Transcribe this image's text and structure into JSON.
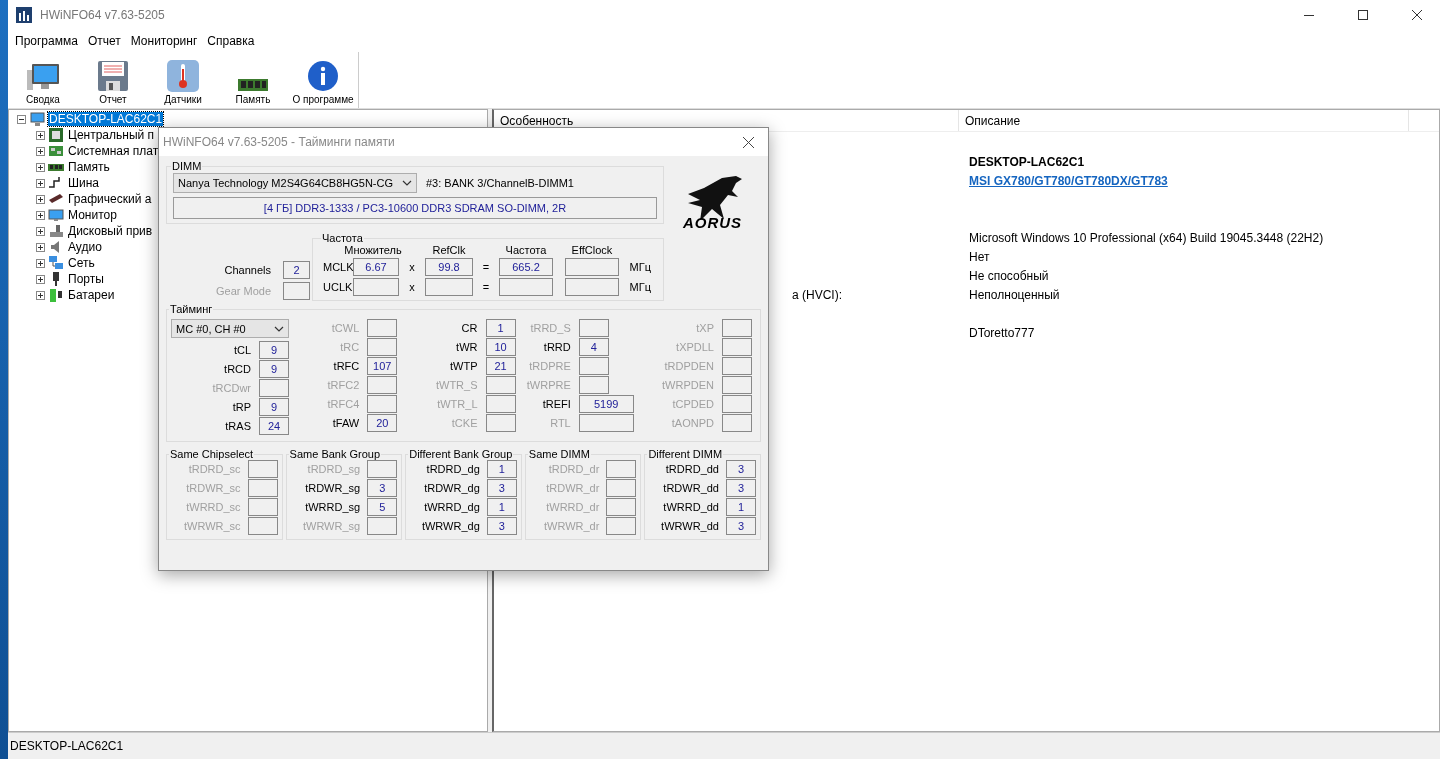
{
  "window": {
    "title": "HWiNFO64 v7.63-5205"
  },
  "menu": [
    "Программа",
    "Отчет",
    "Мониторинг",
    "Справка"
  ],
  "toolbar": [
    {
      "label": "Сводка",
      "kind": "computer"
    },
    {
      "label": "Отчет",
      "kind": "disk"
    },
    {
      "label": "Датчики",
      "kind": "sensor"
    },
    {
      "label": "Память",
      "kind": "memory"
    },
    {
      "label": "О программе",
      "kind": "info"
    }
  ],
  "tree": {
    "label": "DESKTOP-LAC62C1",
    "selected": true,
    "expanded": true,
    "children": [
      {
        "label": "Центральный п",
        "kind": "cpu",
        "selected": false,
        "expanded": false
      },
      {
        "label": "Системная плат",
        "kind": "board",
        "selected": false,
        "expanded": false
      },
      {
        "label": "Память",
        "kind": "memory",
        "selected": false,
        "expanded": false
      },
      {
        "label": "Шина",
        "kind": "bus",
        "selected": false,
        "expanded": false
      },
      {
        "label": "Графический а",
        "kind": "gpu",
        "selected": false,
        "expanded": false
      },
      {
        "label": "Монитор",
        "kind": "monitor",
        "selected": false,
        "expanded": false
      },
      {
        "label": "Дисковый прив",
        "kind": "drive",
        "selected": false,
        "expanded": false
      },
      {
        "label": "Аудио",
        "kind": "audio",
        "selected": false,
        "expanded": false
      },
      {
        "label": "Сеть",
        "kind": "network",
        "selected": false,
        "expanded": false
      },
      {
        "label": "Порты",
        "kind": "port",
        "selected": false,
        "expanded": false
      },
      {
        "label": "Батареи",
        "kind": "battery",
        "selected": false,
        "expanded": false
      }
    ]
  },
  "details": {
    "columns": [
      "Особенность",
      "Описание"
    ],
    "rows": [
      {
        "kind": "bold",
        "value": "DESKTOP-LAC62C1"
      },
      {
        "kind": "link",
        "value": "MSI GX780/GT780/GT780DX/GT783"
      },
      {
        "kind": "blank"
      },
      {
        "kind": "blank"
      },
      {
        "kind": "plain",
        "value": "Microsoft Windows 10 Professional (x64) Build 19045.3448 (22H2)"
      },
      {
        "kind": "plain",
        "value": "Нет"
      },
      {
        "kind": "plain",
        "value": "Не способный"
      },
      {
        "kind": "plain",
        "feature": "а (HVCI):",
        "value": "Неполноценный"
      },
      {
        "kind": "blank"
      },
      {
        "kind": "plain",
        "value": "DToretto777"
      }
    ]
  },
  "status_bar": "DESKTOP-LAC62C1",
  "dialog": {
    "title": "HWiNFO64 v7.63-5205 - Тайминги памяти",
    "dimm": {
      "legend": "DIMM",
      "module": "Nanya Technology M2S4G64CB8HG5N-CG",
      "slot": "#3: BANK 3/ChannelB-DIMM1",
      "info": "[4 ГБ] DDR3-1333 / PC3-10600 DDR3 SDRAM SO-DIMM, 2R"
    },
    "logo_text": "AORUS",
    "channels": [
      {
        "label": "Channels",
        "value": "2",
        "disabled": false
      },
      {
        "label": "Gear Mode",
        "disabled": true
      }
    ],
    "frequency": {
      "legend": "Частота",
      "headers": [
        "Множитель",
        "RefClk",
        "Частота",
        "EffClock"
      ],
      "rows": [
        {
          "label": "MCLK",
          "values": [
            "6.67",
            "99.8",
            "665.2"
          ],
          "operators": [
            "x",
            "="
          ],
          "unit": "МГц"
        },
        {
          "label": "UCLK",
          "values": [],
          "operators": [
            "x",
            "="
          ],
          "unit": "МГц"
        }
      ]
    },
    "timing": {
      "legend": "Тайминг",
      "selector": "MC #0, CH #0",
      "columns": [
        [
          {
            "label": "tCL",
            "value": "9",
            "disabled": false,
            "kind": "narrow"
          },
          {
            "label": "tRCD",
            "value": "9",
            "disabled": false,
            "kind": "narrow"
          },
          {
            "label": "tRCDwr",
            "disabled": true,
            "kind": "narrow"
          },
          {
            "label": "tRP",
            "value": "9",
            "disabled": false,
            "kind": "narrow"
          },
          {
            "label": "tRAS",
            "value": "24",
            "disabled": false,
            "kind": "narrow"
          }
        ],
        [
          {
            "label": "tCWL",
            "disabled": true,
            "kind": "narrow"
          },
          {
            "label": "tRC",
            "disabled": true,
            "kind": "narrow"
          },
          {
            "label": "tRFC",
            "value": "107",
            "disabled": false,
            "kind": "narrow"
          },
          {
            "label": "tRFC2",
            "disabled": true,
            "kind": "narrow"
          },
          {
            "label": "tRFC4",
            "disabled": true,
            "kind": "narrow"
          },
          {
            "label": "tFAW",
            "value": "20",
            "disabled": false,
            "kind": "narrow"
          }
        ],
        [
          {
            "label": "CR",
            "value": "1",
            "disabled": false,
            "kind": "narrow"
          },
          {
            "label": "tWR",
            "value": "10",
            "disabled": false,
            "kind": "narrow"
          },
          {
            "label": "tWTP",
            "value": "21",
            "disabled": false,
            "kind": "narrow"
          },
          {
            "label": "tWTR_S",
            "disabled": true,
            "kind": "narrow"
          },
          {
            "label": "tWTR_L",
            "disabled": true,
            "kind": "narrow"
          },
          {
            "label": "tCKE",
            "disabled": true,
            "kind": "narrow"
          }
        ],
        [
          {
            "label": "tRRD_S",
            "disabled": true,
            "kind": "narrow"
          },
          {
            "label": "tRRD",
            "value": "4",
            "disabled": false,
            "kind": "narrow"
          },
          {
            "label": "tRDPRE",
            "disabled": true,
            "kind": "narrow"
          },
          {
            "label": "tWRPRE",
            "disabled": true,
            "kind": "narrow"
          },
          {
            "label": "tREFI",
            "value": "5199",
            "disabled": false,
            "kind": "wide"
          },
          {
            "label": "RTL",
            "disabled": true,
            "kind": "wide"
          }
        ],
        [
          {
            "label": "tXP",
            "disabled": true,
            "kind": "narrow"
          },
          {
            "label": "tXPDLL",
            "disabled": true,
            "kind": "narrow"
          },
          {
            "label": "tRDPDEN",
            "disabled": true,
            "kind": "narrow"
          },
          {
            "label": "tWRPDEN",
            "disabled": true,
            "kind": "narrow"
          },
          {
            "label": "tCPDED",
            "disabled": true,
            "kind": "narrow"
          },
          {
            "label": "tAONPD",
            "disabled": true,
            "kind": "narrow"
          }
        ]
      ]
    },
    "groups": [
      {
        "legend": "Same Chipselect",
        "rows": [
          {
            "label": "tRDRD_sc",
            "disabled": true
          },
          {
            "label": "tRDWR_sc",
            "disabled": true
          },
          {
            "label": "tWRRD_sc",
            "disabled": true
          },
          {
            "label": "tWRWR_sc",
            "disabled": true
          }
        ]
      },
      {
        "legend": "Same Bank Group",
        "rows": [
          {
            "label": "tRDRD_sg",
            "disabled": true
          },
          {
            "label": "tRDWR_sg",
            "value": "3",
            "disabled": false
          },
          {
            "label": "tWRRD_sg",
            "value": "5",
            "disabled": false
          },
          {
            "label": "tWRWR_sg",
            "disabled": true
          }
        ]
      },
      {
        "legend": "Different Bank Group",
        "rows": [
          {
            "label": "tRDRD_dg",
            "value": "1",
            "disabled": false
          },
          {
            "label": "tRDWR_dg",
            "value": "3",
            "disabled": false
          },
          {
            "label": "tWRRD_dg",
            "value": "1",
            "disabled": false
          },
          {
            "label": "tWRWR_dg",
            "value": "3",
            "disabled": false
          }
        ]
      },
      {
        "legend": "Same DIMM",
        "rows": [
          {
            "label": "tRDRD_dr",
            "disabled": true
          },
          {
            "label": "tRDWR_dr",
            "disabled": true
          },
          {
            "label": "tWRRD_dr",
            "disabled": true
          },
          {
            "label": "tWRWR_dr",
            "disabled": true
          }
        ]
      },
      {
        "legend": "Different DIMM",
        "rows": [
          {
            "label": "tRDRD_dd",
            "value": "3",
            "disabled": false
          },
          {
            "label": "tRDWR_dd",
            "value": "3",
            "disabled": false
          },
          {
            "label": "tWRRD_dd",
            "value": "1",
            "disabled": false
          },
          {
            "label": "tWRWR_dd",
            "value": "3",
            "disabled": false
          }
        ]
      }
    ]
  }
}
